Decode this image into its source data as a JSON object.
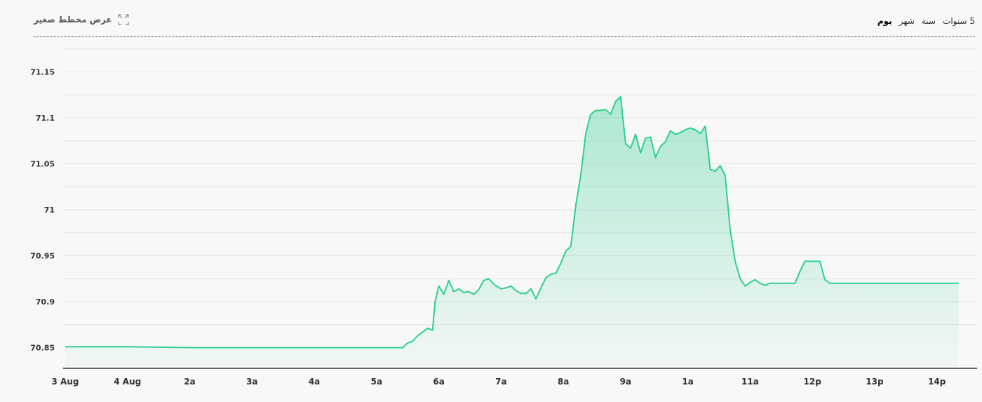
{
  "toolbar": {
    "mini_chart_label": "عرض مخطط صغير",
    "periods": [
      {
        "label": "يوم",
        "active": true
      },
      {
        "label": "شهر",
        "active": false
      },
      {
        "label": "سنة",
        "active": false
      },
      {
        "label": "5 سنوات",
        "active": false
      }
    ]
  },
  "chart_data": {
    "type": "area",
    "title": "",
    "xlabel": "",
    "ylabel": "",
    "ylim": [
      70.84,
      71.2
    ],
    "grid": true,
    "colors": {
      "line": "#2fcf8e",
      "fill": "#2fcf8e",
      "grid": "#e4e4e4",
      "axis": "#333333"
    },
    "x_ticks": [
      {
        "pos": 0,
        "label": "3 Aug"
      },
      {
        "pos": 1,
        "label": "4 Aug"
      },
      {
        "pos": 2,
        "label": "2a"
      },
      {
        "pos": 3,
        "label": "3a"
      },
      {
        "pos": 4,
        "label": "4a"
      },
      {
        "pos": 5,
        "label": "5a"
      },
      {
        "pos": 6,
        "label": "6a"
      },
      {
        "pos": 7,
        "label": "7a"
      },
      {
        "pos": 8,
        "label": "8a"
      },
      {
        "pos": 9,
        "label": "9a"
      },
      {
        "pos": 10,
        "label": "1a"
      },
      {
        "pos": 11,
        "label": "11a"
      },
      {
        "pos": 12,
        "label": "12p"
      },
      {
        "pos": 13,
        "label": "13p"
      },
      {
        "pos": 14,
        "label": "14p"
      }
    ],
    "y_ticks": [
      {
        "value": 70.85,
        "label": "70.85"
      },
      {
        "value": 70.9,
        "label": "70.9"
      },
      {
        "value": 70.95,
        "label": "70.95"
      },
      {
        "value": 71.0,
        "label": "71"
      },
      {
        "value": 71.05,
        "label": "71.05"
      },
      {
        "value": 71.1,
        "label": "71.1"
      },
      {
        "value": 71.15,
        "label": "71.15"
      }
    ],
    "series": [
      {
        "x": [
          0,
          1.0,
          2.0,
          3.0,
          4.0,
          5.0,
          5.42,
          5.5,
          5.58,
          5.66,
          5.74,
          5.82,
          5.9,
          5.94,
          6.0,
          6.08,
          6.16,
          6.24,
          6.32,
          6.4,
          6.48,
          6.56,
          6.64,
          6.72,
          6.8,
          6.9,
          7.0,
          7.08,
          7.16,
          7.24,
          7.32,
          7.4,
          7.48,
          7.56,
          7.64,
          7.72,
          7.8,
          7.88,
          7.96,
          8.04,
          8.12,
          8.2,
          8.28,
          8.36,
          8.44,
          8.52,
          8.6,
          8.68,
          8.76,
          8.84,
          8.92,
          9.0,
          9.08,
          9.16,
          9.24,
          9.32,
          9.4,
          9.48,
          9.56,
          9.64,
          9.72,
          9.8,
          9.88,
          9.96,
          10.04,
          10.12,
          10.2,
          10.28,
          10.36,
          10.44,
          10.52,
          10.6,
          10.68,
          10.76,
          10.84,
          10.92,
          11.0,
          11.08,
          11.16,
          11.24,
          11.32,
          11.4,
          11.48,
          11.56,
          11.64,
          11.72,
          11.8,
          11.88,
          11.96,
          12.04,
          12.12,
          12.2,
          12.28,
          12.36,
          12.44,
          12.52,
          12.6,
          12.7,
          12.8,
          13.0,
          13.5,
          14.0,
          14.35
        ],
        "y": [
          70.851,
          70.851,
          70.85,
          70.85,
          70.85,
          70.85,
          70.85,
          70.855,
          70.857,
          70.863,
          70.867,
          70.871,
          70.869,
          70.9,
          70.917,
          70.908,
          70.923,
          70.911,
          70.914,
          70.91,
          70.911,
          70.908,
          70.913,
          70.923,
          70.925,
          70.918,
          70.914,
          70.915,
          70.917,
          70.912,
          70.909,
          70.909,
          70.914,
          70.903,
          70.915,
          70.926,
          70.93,
          70.931,
          70.942,
          70.955,
          70.96,
          71.005,
          71.038,
          71.083,
          71.104,
          71.108,
          71.108,
          71.109,
          71.104,
          71.118,
          71.123,
          71.072,
          71.067,
          71.082,
          71.062,
          71.078,
          71.079,
          71.057,
          71.069,
          71.074,
          71.086,
          71.082,
          71.084,
          71.087,
          71.089,
          71.087,
          71.083,
          71.091,
          71.044,
          71.042,
          71.048,
          71.037,
          70.978,
          70.944,
          70.925,
          70.917,
          70.921,
          70.924,
          70.92,
          70.918,
          70.92,
          70.92,
          70.92,
          70.92,
          70.92,
          70.92,
          70.933,
          70.944,
          70.944,
          70.944,
          70.944,
          70.924,
          70.92,
          70.92,
          70.92,
          70.92,
          70.92,
          70.92,
          70.92,
          70.92,
          70.92,
          70.92,
          70.92
        ]
      }
    ]
  }
}
